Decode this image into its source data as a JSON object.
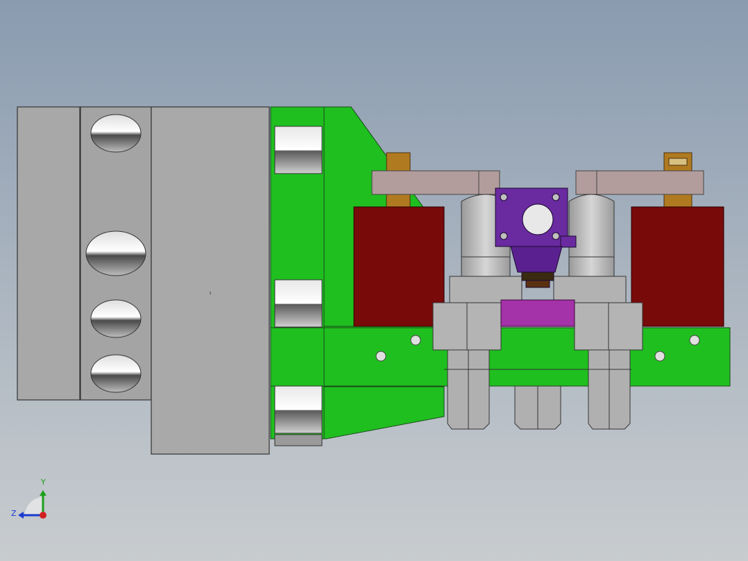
{
  "viewport": {
    "background_top": "#8a9bb0",
    "background_bottom": "#c8cccf"
  },
  "model": {
    "colors": {
      "steel": "#a7a7a7",
      "green_plate": "#1fbf1f",
      "red_block": "#7a0a0a",
      "purple_bracket": "#6a2aa0",
      "magenta_plate": "#a432a8",
      "brass": "#b07a20",
      "beam": "#b09a9a"
    }
  },
  "triad": {
    "y_label": "Y",
    "z_label": "Z",
    "y_color": "#1aa01a",
    "z_color": "#1a3ad0",
    "origin_color": "#d02020"
  }
}
